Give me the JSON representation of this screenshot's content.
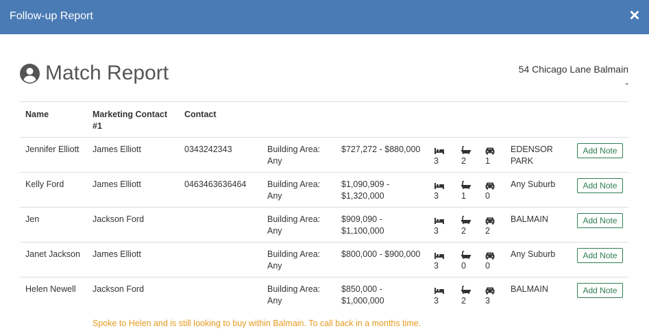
{
  "modal": {
    "title": "Follow-up Report"
  },
  "report": {
    "title": "Match Report",
    "address_line1": "54 Chicago Lane Balmain",
    "address_line2": "-"
  },
  "table": {
    "headers": {
      "name": "Name",
      "marketing_contact": "Marketing Contact #1",
      "contact": "Contact"
    },
    "rows": [
      {
        "name": "Jennifer Elliott",
        "marketing_contact": "James Elliott",
        "contact": "0343242343",
        "area_label": "Building Area:",
        "area_value": "Any",
        "price_line1": "$727,272 - $880,000",
        "price_line2": "",
        "beds": "3",
        "baths": "2",
        "cars": "1",
        "suburb_line1": "EDENSOR",
        "suburb_line2": "PARK",
        "button": "Add Note"
      },
      {
        "name": "Kelly Ford",
        "marketing_contact": "James Elliott",
        "contact": "0463463636464",
        "area_label": "Building Area:",
        "area_value": "Any",
        "price_line1": "$1,090,909 -",
        "price_line2": "$1,320,000",
        "beds": "3",
        "baths": "1",
        "cars": "0",
        "suburb_line1": "Any Suburb",
        "suburb_line2": "",
        "button": "Add Note"
      },
      {
        "name": "Jen",
        "marketing_contact": "Jackson Ford",
        "contact": "",
        "area_label": "Building Area:",
        "area_value": "Any",
        "price_line1": "$909,090 -",
        "price_line2": "$1,100,000",
        "beds": "3",
        "baths": "2",
        "cars": "2",
        "suburb_line1": "BALMAIN",
        "suburb_line2": "",
        "button": "Add Note"
      },
      {
        "name": "Janet Jackson",
        "marketing_contact": "James Elliott",
        "contact": "",
        "area_label": "Building Area:",
        "area_value": "Any",
        "price_line1": "$800,000 - $900,000",
        "price_line2": "",
        "beds": "3",
        "baths": "0",
        "cars": "0",
        "suburb_line1": "Any Suburb",
        "suburb_line2": "",
        "button": "Add Note"
      },
      {
        "name": "Helen Newell",
        "marketing_contact": "Jackson Ford",
        "contact": "",
        "area_label": "Building Area:",
        "area_value": "Any",
        "price_line1": "$850,000 -",
        "price_line2": "$1,000,000",
        "beds": "3",
        "baths": "2",
        "cars": "3",
        "suburb_line1": "BALMAIN",
        "suburb_line2": "",
        "button": "Add Note"
      }
    ],
    "note": "Spoke to Helen and is still looking to buy within Balmain. To call back in a months time."
  },
  "colors": {
    "header_bg": "#4a7bb5",
    "button": "#2e7d52",
    "note": "#e59a1d"
  },
  "icons": {
    "close": "close-icon",
    "user": "user-circle-icon",
    "bed": "bed-icon",
    "bath": "bath-icon",
    "car": "car-icon"
  }
}
